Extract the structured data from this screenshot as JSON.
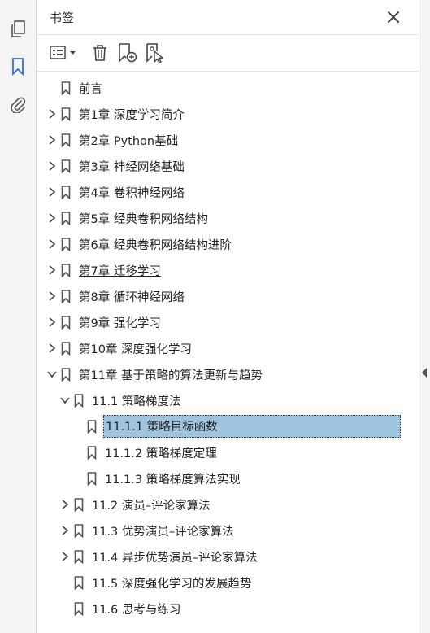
{
  "panel": {
    "title": "书签"
  },
  "colors": {
    "selected_bg": "#9ec4e0",
    "icon": "#555555",
    "accent_blue": "#2f6fd6"
  },
  "leftbar": {
    "icons": [
      "pages-icon",
      "bookmark-icon",
      "paperclip-icon"
    ]
  },
  "toolbar": {
    "icons": [
      "options-menu-icon",
      "delete-icon",
      "new-bookmark-icon",
      "new-bookmark-from-structure-icon"
    ]
  },
  "bookmarks": [
    {
      "label": "前言",
      "level": 0,
      "expander": "none"
    },
    {
      "label": "第1章 深度学习简介",
      "level": 0,
      "expander": "collapsed"
    },
    {
      "label": "第2章 Python基础",
      "level": 0,
      "expander": "collapsed"
    },
    {
      "label": "第3章 神经网络基础",
      "level": 0,
      "expander": "collapsed"
    },
    {
      "label": "第4章 卷积神经网络",
      "level": 0,
      "expander": "collapsed"
    },
    {
      "label": "第5章 经典卷积网络结构",
      "level": 0,
      "expander": "collapsed"
    },
    {
      "label": "第6章 经典卷积网络结构进阶",
      "level": 0,
      "expander": "collapsed"
    },
    {
      "label": "第7章 迁移学习",
      "level": 0,
      "expander": "collapsed",
      "underline": true
    },
    {
      "label": "第8章 循环神经网络",
      "level": 0,
      "expander": "collapsed"
    },
    {
      "label": "第9章 强化学习",
      "level": 0,
      "expander": "collapsed"
    },
    {
      "label": "第10章 深度强化学习",
      "level": 0,
      "expander": "collapsed"
    },
    {
      "label": "第11章 基于策略的算法更新与趋势",
      "level": 0,
      "expander": "expanded"
    },
    {
      "label": "11.1 策略梯度法",
      "level": 1,
      "expander": "expanded"
    },
    {
      "label": "11.1.1 策略目标函数",
      "level": 2,
      "expander": "none",
      "selected": true
    },
    {
      "label": "11.1.2 策略梯度定理",
      "level": 2,
      "expander": "none"
    },
    {
      "label": "11.1.3 策略梯度算法实现",
      "level": 2,
      "expander": "none"
    },
    {
      "label": "11.2 演员–评论家算法",
      "level": 1,
      "expander": "collapsed"
    },
    {
      "label": "11.3 优势演员–评论家算法",
      "level": 1,
      "expander": "collapsed"
    },
    {
      "label": "11.4 异步优势演员–评论家算法",
      "level": 1,
      "expander": "collapsed"
    },
    {
      "label": "11.5 深度强化学习的发展趋势",
      "level": 1,
      "expander": "none"
    },
    {
      "label": "11.6 思考与练习",
      "level": 1,
      "expander": "none"
    }
  ]
}
